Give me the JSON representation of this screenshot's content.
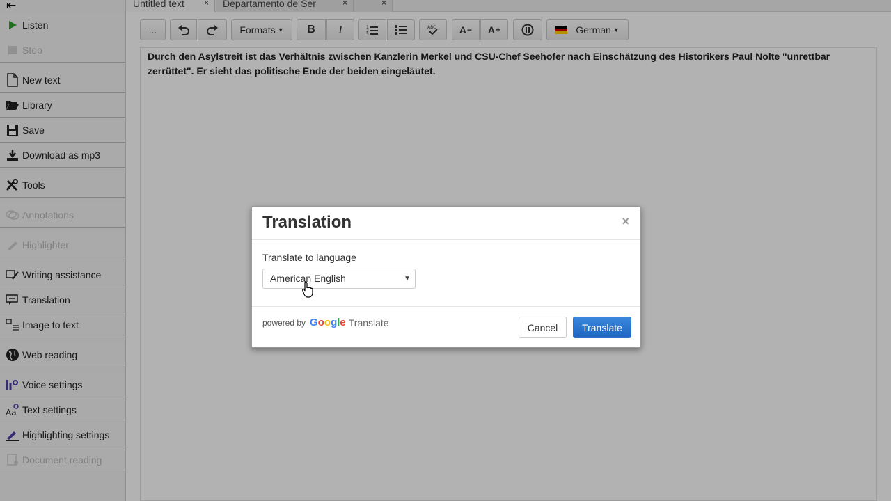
{
  "tabs": [
    {
      "label": "Untitled text",
      "close": "×"
    },
    {
      "label": "Departamento de Ser",
      "close": "×"
    },
    {
      "label": "",
      "close": "×"
    }
  ],
  "sidebar": {
    "back_symbol": "⇤",
    "items": [
      {
        "label": "Listen",
        "icon": "play-icon",
        "disabled": false
      },
      {
        "label": "Stop",
        "icon": "stop-icon",
        "disabled": true
      },
      {
        "label": "New text",
        "icon": "new-document-icon",
        "disabled": false
      },
      {
        "label": "Library",
        "icon": "folder-open-icon",
        "disabled": false
      },
      {
        "label": "Save",
        "icon": "floppy-disk-icon",
        "disabled": false
      },
      {
        "label": "Download as mp3",
        "icon": "download-icon",
        "disabled": false
      },
      {
        "label": "Tools",
        "icon": "tools-icon",
        "disabled": false
      },
      {
        "label": "Annotations",
        "icon": "comments-icon",
        "disabled": true
      },
      {
        "label": "Highlighter",
        "icon": "highlighter-icon",
        "disabled": true
      },
      {
        "label": "Writing assistance",
        "icon": "writing-assist-icon",
        "disabled": false
      },
      {
        "label": "Translation",
        "icon": "translation-icon",
        "disabled": false
      },
      {
        "label": "Image to text",
        "icon": "image-to-text-icon",
        "disabled": false
      },
      {
        "label": "Web reading",
        "icon": "globe-icon",
        "disabled": false
      },
      {
        "label": "Voice settings",
        "icon": "voice-settings-icon",
        "disabled": false
      },
      {
        "label": "Text settings",
        "icon": "text-settings-icon",
        "disabled": false
      },
      {
        "label": "Highlighting settings",
        "icon": "highlighting-settings-icon",
        "disabled": false
      },
      {
        "label": "Document reading",
        "icon": "document-reading-icon",
        "disabled": true
      }
    ]
  },
  "toolbar": {
    "more_label": "...",
    "formats_label": "Formats",
    "bold_label": "B",
    "italic_label": "I",
    "decrease_font_label": "A",
    "increase_font_label": "A",
    "language_label": "German",
    "language_flag_colors": [
      "#000000",
      "#dd0000",
      "#ffce00"
    ]
  },
  "editor": {
    "text": "Durch den Asylstreit ist das Verhältnis zwischen Kanzlerin Merkel und CSU-Chef Seehofer nach Einschätzung des Historikers Paul Nolte \"unrettbar zerrüttet\". Er sieht das politische Ende der beiden eingeläutet."
  },
  "modal": {
    "title": "Translation",
    "close": "×",
    "field_label": "Translate to language",
    "selected_language": "American English",
    "powered_by": "powered by",
    "google_letters": [
      "G",
      "o",
      "o",
      "g",
      "l",
      "e"
    ],
    "google_colors": [
      "#4285f4",
      "#ea4335",
      "#fbbc05",
      "#4285f4",
      "#34a853",
      "#ea4335"
    ],
    "translate_word": "Translate",
    "cancel_label": "Cancel",
    "translate_label": "Translate"
  },
  "colors": {
    "primary_button": "#1e65c0",
    "listen_green": "#2e9e2e"
  }
}
